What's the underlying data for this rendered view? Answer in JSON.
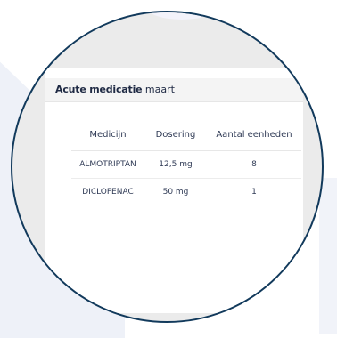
{
  "card": {
    "title_bold": "Acute medicatie",
    "title_rest": "maart"
  },
  "table": {
    "headers": [
      "Medicijn",
      "Dosering",
      "Aantal eenheden"
    ],
    "rows": [
      {
        "medicijn": "ALMOTRIPTAN",
        "dosering": "12,5 mg",
        "aantal": "8"
      },
      {
        "medicijn": "DICLOFENAC",
        "dosering": "50 mg",
        "aantal": "1"
      }
    ]
  },
  "colors": {
    "ring": "#123a5c",
    "header_bg": "#f4f4f4",
    "text": "#2f3a55"
  }
}
